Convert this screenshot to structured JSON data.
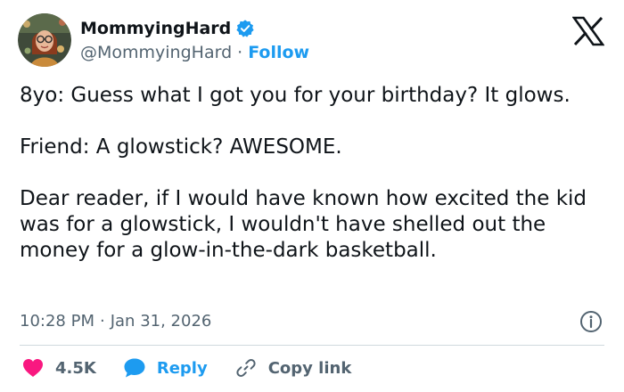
{
  "author": {
    "display_name": "MommyingHard",
    "handle": "@MommyingHard",
    "separator": "·",
    "follow_label": "Follow",
    "verified": true
  },
  "post": {
    "paragraphs": [
      "8yo: Guess what I got you for your birthday? It glows.",
      "Friend: A glowstick? AWESOME.",
      "Dear reader, if I would have known how excited the kid was for a glowstick, I wouldn't have shelled out the money for a glow-in-the-dark basketball."
    ],
    "time": "10:28 PM",
    "meta_separator": "·",
    "date": "Jan 31, 2026"
  },
  "actions": {
    "likes_count": "4.5K",
    "reply_label": "Reply",
    "copy_link_label": "Copy link"
  },
  "icons": {
    "logo": "x-logo-icon",
    "verified": "verified-badge-icon",
    "info": "info-icon",
    "like": "heart-icon",
    "reply": "speech-bubble-icon",
    "copy": "link-icon"
  },
  "colors": {
    "accent": "#1d9bf0",
    "like": "#f91880",
    "text": "#0f1419",
    "muted": "#536471",
    "divider": "#cfd9de"
  }
}
